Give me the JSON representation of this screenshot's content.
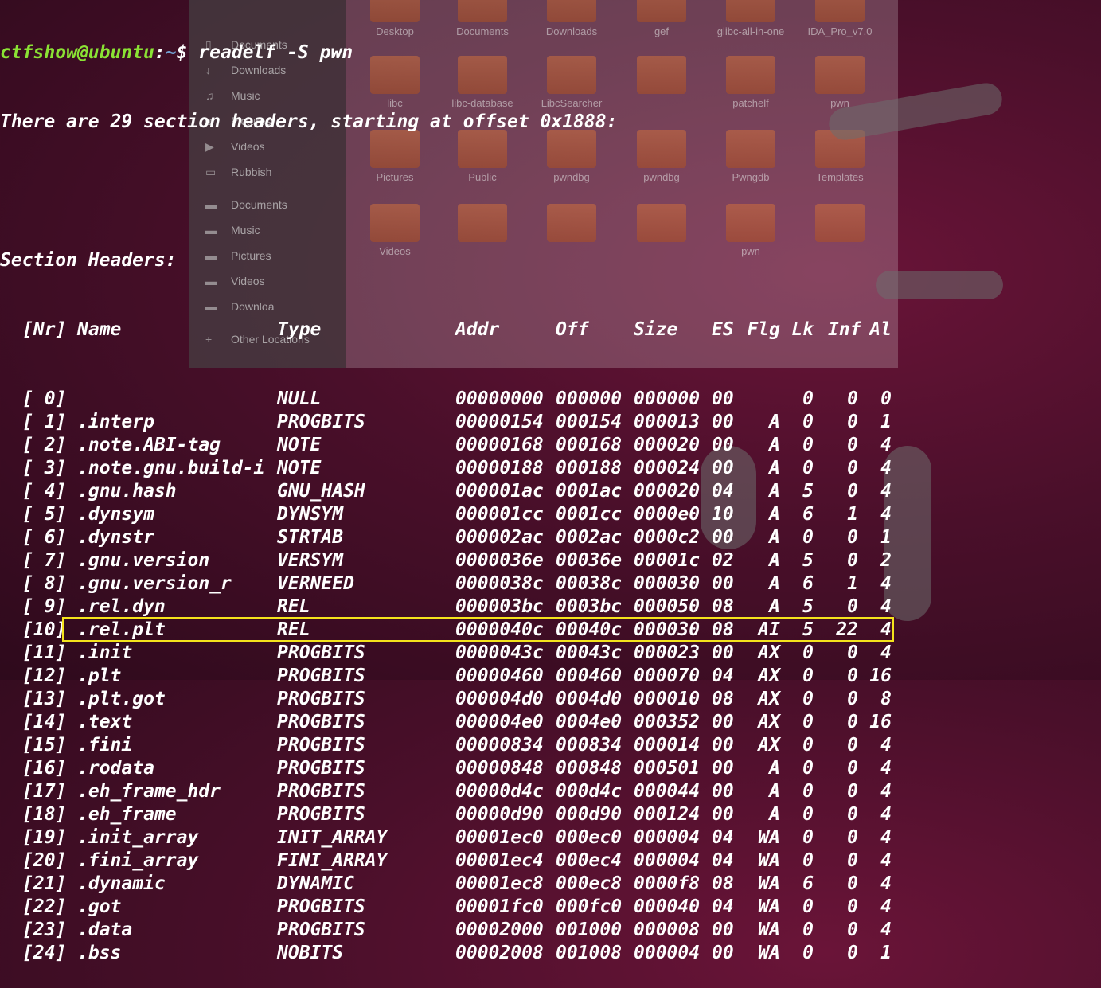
{
  "terminal": {
    "prompt_user": "ctfshow@ubuntu",
    "prompt_sep": ":",
    "prompt_path": "~",
    "prompt_symbol": "$ ",
    "command": "readelf -S pwn",
    "summary": "There are 29 section headers, starting at offset 0x1888:",
    "section_title": "Section Headers:",
    "headers": [
      "[Nr]",
      "Name",
      "Type",
      "Addr",
      "Off",
      "Size",
      "ES",
      "Flg",
      "Lk",
      "Inf",
      "Al"
    ],
    "rows": [
      [
        "[ 0]",
        "",
        "NULL",
        "00000000",
        "000000",
        "000000",
        "00",
        "",
        "0",
        "0",
        "0"
      ],
      [
        "[ 1]",
        ".interp",
        "PROGBITS",
        "00000154",
        "000154",
        "000013",
        "00",
        "A",
        "0",
        "0",
        "1"
      ],
      [
        "[ 2]",
        ".note.ABI-tag",
        "NOTE",
        "00000168",
        "000168",
        "000020",
        "00",
        "A",
        "0",
        "0",
        "4"
      ],
      [
        "[ 3]",
        ".note.gnu.build-i",
        "NOTE",
        "00000188",
        "000188",
        "000024",
        "00",
        "A",
        "0",
        "0",
        "4"
      ],
      [
        "[ 4]",
        ".gnu.hash",
        "GNU_HASH",
        "000001ac",
        "0001ac",
        "000020",
        "04",
        "A",
        "5",
        "0",
        "4"
      ],
      [
        "[ 5]",
        ".dynsym",
        "DYNSYM",
        "000001cc",
        "0001cc",
        "0000e0",
        "10",
        "A",
        "6",
        "1",
        "4"
      ],
      [
        "[ 6]",
        ".dynstr",
        "STRTAB",
        "000002ac",
        "0002ac",
        "0000c2",
        "00",
        "A",
        "0",
        "0",
        "1"
      ],
      [
        "[ 7]",
        ".gnu.version",
        "VERSYM",
        "0000036e",
        "00036e",
        "00001c",
        "02",
        "A",
        "5",
        "0",
        "2"
      ],
      [
        "[ 8]",
        ".gnu.version_r",
        "VERNEED",
        "0000038c",
        "00038c",
        "000030",
        "00",
        "A",
        "6",
        "1",
        "4"
      ],
      [
        "[ 9]",
        ".rel.dyn",
        "REL",
        "000003bc",
        "0003bc",
        "000050",
        "08",
        "A",
        "5",
        "0",
        "4"
      ],
      [
        "[10]",
        ".rel.plt",
        "REL",
        "0000040c",
        "00040c",
        "000030",
        "08",
        "AI",
        "5",
        "22",
        "4"
      ],
      [
        "[11]",
        ".init",
        "PROGBITS",
        "0000043c",
        "00043c",
        "000023",
        "00",
        "AX",
        "0",
        "0",
        "4"
      ],
      [
        "[12]",
        ".plt",
        "PROGBITS",
        "00000460",
        "000460",
        "000070",
        "04",
        "AX",
        "0",
        "0",
        "16"
      ],
      [
        "[13]",
        ".plt.got",
        "PROGBITS",
        "000004d0",
        "0004d0",
        "000010",
        "08",
        "AX",
        "0",
        "0",
        "8"
      ],
      [
        "[14]",
        ".text",
        "PROGBITS",
        "000004e0",
        "0004e0",
        "000352",
        "00",
        "AX",
        "0",
        "0",
        "16"
      ],
      [
        "[15]",
        ".fini",
        "PROGBITS",
        "00000834",
        "000834",
        "000014",
        "00",
        "AX",
        "0",
        "0",
        "4"
      ],
      [
        "[16]",
        ".rodata",
        "PROGBITS",
        "00000848",
        "000848",
        "000501",
        "00",
        "A",
        "0",
        "0",
        "4"
      ],
      [
        "[17]",
        ".eh_frame_hdr",
        "PROGBITS",
        "00000d4c",
        "000d4c",
        "000044",
        "00",
        "A",
        "0",
        "0",
        "4"
      ],
      [
        "[18]",
        ".eh_frame",
        "PROGBITS",
        "00000d90",
        "000d90",
        "000124",
        "00",
        "A",
        "0",
        "0",
        "4"
      ],
      [
        "[19]",
        ".init_array",
        "INIT_ARRAY",
        "00001ec0",
        "000ec0",
        "000004",
        "04",
        "WA",
        "0",
        "0",
        "4"
      ],
      [
        "[20]",
        ".fini_array",
        "FINI_ARRAY",
        "00001ec4",
        "000ec4",
        "000004",
        "04",
        "WA",
        "0",
        "0",
        "4"
      ],
      [
        "[21]",
        ".dynamic",
        "DYNAMIC",
        "00001ec8",
        "000ec8",
        "0000f8",
        "08",
        "WA",
        "6",
        "0",
        "4"
      ],
      [
        "[22]",
        ".got",
        "PROGBITS",
        "00001fc0",
        "000fc0",
        "000040",
        "04",
        "WA",
        "0",
        "0",
        "4"
      ],
      [
        "[23]",
        ".data",
        "PROGBITS",
        "00002000",
        "001000",
        "000008",
        "00",
        "WA",
        "0",
        "0",
        "4"
      ],
      [
        "[24]",
        ".bss",
        "NOBITS",
        "00002008",
        "001008",
        "000004",
        "00",
        "WA",
        "0",
        "0",
        "1"
      ]
    ],
    "highlighted_row": "[22]",
    "highlight_color": "#f4e31c"
  },
  "file_manager": {
    "sidebar": [
      {
        "icon": "file-icon",
        "label": "Documents"
      },
      {
        "icon": "download-icon",
        "label": "Downloads"
      },
      {
        "icon": "music-icon",
        "label": "Music"
      },
      {
        "icon": "camera-icon",
        "label": "Pictures"
      },
      {
        "icon": "video-icon",
        "label": "Videos"
      },
      {
        "icon": "trash-icon",
        "label": "Rubbish"
      },
      {
        "icon": "folder-icon",
        "label": "Documents"
      },
      {
        "icon": "folder-icon",
        "label": "Music"
      },
      {
        "icon": "folder-icon",
        "label": "Pictures"
      },
      {
        "icon": "folder-icon",
        "label": "Videos"
      },
      {
        "icon": "folder-icon",
        "label": "Downloa"
      },
      {
        "icon": "plus-icon",
        "label": "Other Locations"
      }
    ],
    "folders": [
      "Desktop",
      "Documents",
      "Downloads",
      "gef",
      "glibc-all-in-one",
      "IDA_Pro_v7.0",
      "libc",
      "libc-database",
      "LibcSearcher",
      "",
      "patchelf",
      "pwn",
      "Pictures",
      "Public",
      "pwndbg",
      "pwndbg",
      "Pwngdb",
      "Templates",
      "Videos",
      "",
      "",
      "",
      "pwn",
      ""
    ]
  },
  "colors": {
    "prompt_user": "#8ae234",
    "prompt_path": "#729fcf",
    "text": "#ffffff"
  }
}
